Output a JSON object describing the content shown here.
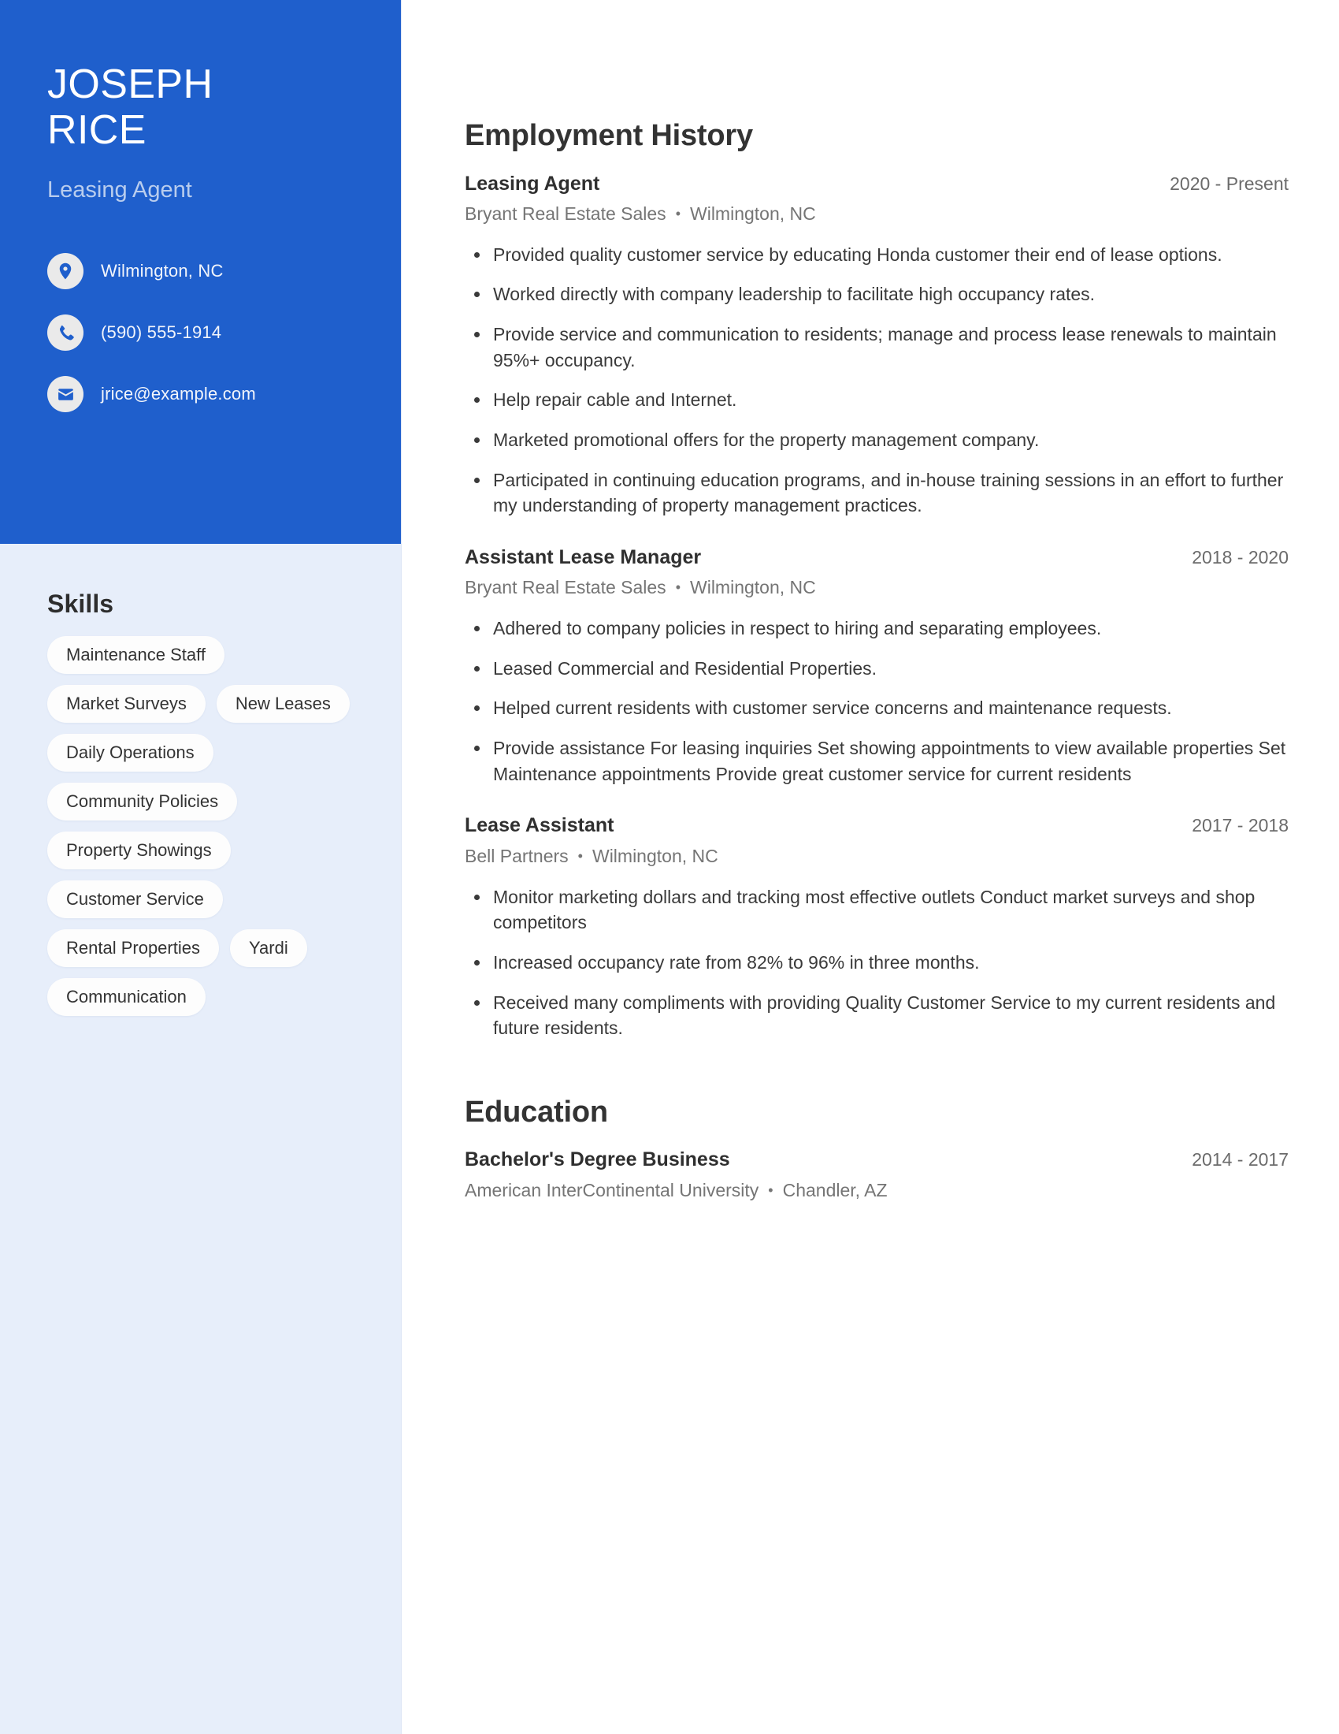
{
  "colors": {
    "accent_blue": "#1f5fcc",
    "sidebar_light": "#e7eefa",
    "pill_white": "#fdfdfd",
    "heading_dark": "#333333",
    "muted_gray": "#757575"
  },
  "header": {
    "first_name": "JOSEPH",
    "last_name": "RICE",
    "job_title": "Leasing Agent"
  },
  "contacts": [
    {
      "icon": "location-pin-icon",
      "text": "Wilmington, NC"
    },
    {
      "icon": "phone-icon",
      "text": "(590) 555-1914"
    },
    {
      "icon": "envelope-icon",
      "text": "jrice@example.com"
    }
  ],
  "skills": {
    "heading": "Skills",
    "items": [
      "Maintenance Staff",
      "Market Surveys",
      "New Leases",
      "Daily Operations",
      "Community Policies",
      "Property Showings",
      "Customer Service",
      "Rental Properties",
      "Yardi",
      "Communication"
    ]
  },
  "employment": {
    "heading": "Employment History",
    "entries": [
      {
        "title": "Leasing Agent",
        "dates": "2020 - Present",
        "company": "Bryant Real Estate Sales",
        "location": "Wilmington, NC",
        "bullets": [
          "Provided quality customer service by educating Honda customer their end of lease options.",
          "Worked directly with company leadership to facilitate high occupancy rates.",
          "Provide service and communication to residents; manage and process lease renewals to maintain 95%+ occupancy.",
          "Help repair cable and Internet.",
          "Marketed promotional offers for the property management company.",
          "Participated in continuing education programs, and in-house training sessions in an effort to further my understanding of property management practices."
        ]
      },
      {
        "title": "Assistant Lease Manager",
        "dates": "2018 - 2020",
        "company": "Bryant Real Estate Sales",
        "location": "Wilmington, NC",
        "bullets": [
          "Adhered to company policies in respect to hiring and separating employees.",
          "Leased Commercial and Residential Properties.",
          "Helped current residents with customer service concerns and maintenance requests.",
          "Provide assistance For leasing inquiries Set showing appointments to view available properties Set Maintenance appointments Provide great customer service for current residents"
        ]
      },
      {
        "title": "Lease Assistant",
        "dates": "2017 - 2018",
        "company": "Bell Partners",
        "location": "Wilmington, NC",
        "bullets": [
          "Monitor marketing dollars and tracking most effective outlets Conduct market surveys and shop competitors",
          "Increased occupancy rate from 82% to 96% in three months.",
          "Received many compliments with providing Quality Customer Service to my current residents and future residents."
        ]
      }
    ]
  },
  "education": {
    "heading": "Education",
    "entries": [
      {
        "title": "Bachelor's Degree Business",
        "dates": "2014 - 2017",
        "school": "American InterContinental University",
        "location": "Chandler, AZ"
      }
    ]
  },
  "separator": "•"
}
